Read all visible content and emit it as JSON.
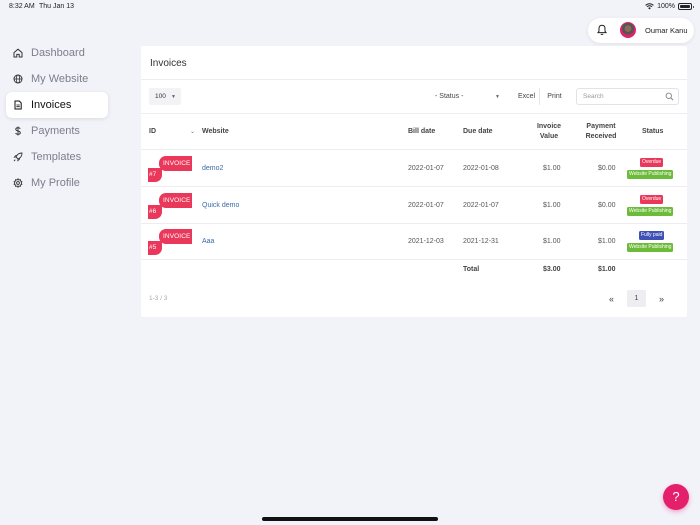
{
  "status_bar": {
    "time": "8:32 AM",
    "date": "Thu Jan 13",
    "battery": "100%"
  },
  "user": {
    "name": "Oumar Kanu",
    "bell_icon": "bell-icon"
  },
  "sidebar": {
    "items": [
      {
        "label": "Dashboard",
        "icon": "home-icon",
        "active": false
      },
      {
        "label": "My Website",
        "icon": "globe-icon",
        "active": false
      },
      {
        "label": "Invoices",
        "icon": "document-icon",
        "active": true
      },
      {
        "label": "Payments",
        "icon": "dollar-icon",
        "active": false
      },
      {
        "label": "Templates",
        "icon": "rocket-icon",
        "active": false
      },
      {
        "label": "My Profile",
        "icon": "gear-icon",
        "active": false
      }
    ]
  },
  "invoices": {
    "title": "Invoices",
    "per_page": "100",
    "status_filter": "- Status -",
    "excel_label": "Excel",
    "print_label": "Print",
    "search_placeholder": "Search",
    "columns": {
      "id": "ID",
      "website": "Website",
      "bill_date": "Bill date",
      "due_date": "Due date",
      "invoice_value_1": "Invoice",
      "invoice_value_2": "Value",
      "payment_received_1": "Payment",
      "payment_received_2": "Received",
      "status": "Status"
    },
    "rows": [
      {
        "tag": "INVOICE",
        "num": "#7",
        "website": "demo2",
        "bill_date": "2022-01-07",
        "due_date": "2022-01-08",
        "value": "$1.00",
        "received": "$0.00",
        "status": "Overdue",
        "category": "Website Publishing"
      },
      {
        "tag": "INVOICE",
        "num": "#6",
        "website": "Quick demo",
        "bill_date": "2022-01-07",
        "due_date": "2022-01-07",
        "value": "$1.00",
        "received": "$0.00",
        "status": "Overdue",
        "category": "Website Publishing"
      },
      {
        "tag": "INVOICE",
        "num": "#5",
        "website": "Aaa",
        "bill_date": "2021-12-03",
        "due_date": "2021-12-31",
        "value": "$1.00",
        "received": "$1.00",
        "status": "Fully paid",
        "category": "Website Publishing"
      }
    ],
    "total": {
      "label": "Total",
      "value": "$3.00",
      "received": "$1.00"
    },
    "records_info": "1-3 / 3",
    "pager": {
      "prev": "«",
      "current": "1",
      "next": "»"
    }
  },
  "help_label": "?",
  "colors": {
    "accent": "#e4206c",
    "overdue": "#e9385a",
    "paid": "#3f51b5",
    "publishing": "#6dbb3a",
    "link": "#3a6aa8"
  }
}
